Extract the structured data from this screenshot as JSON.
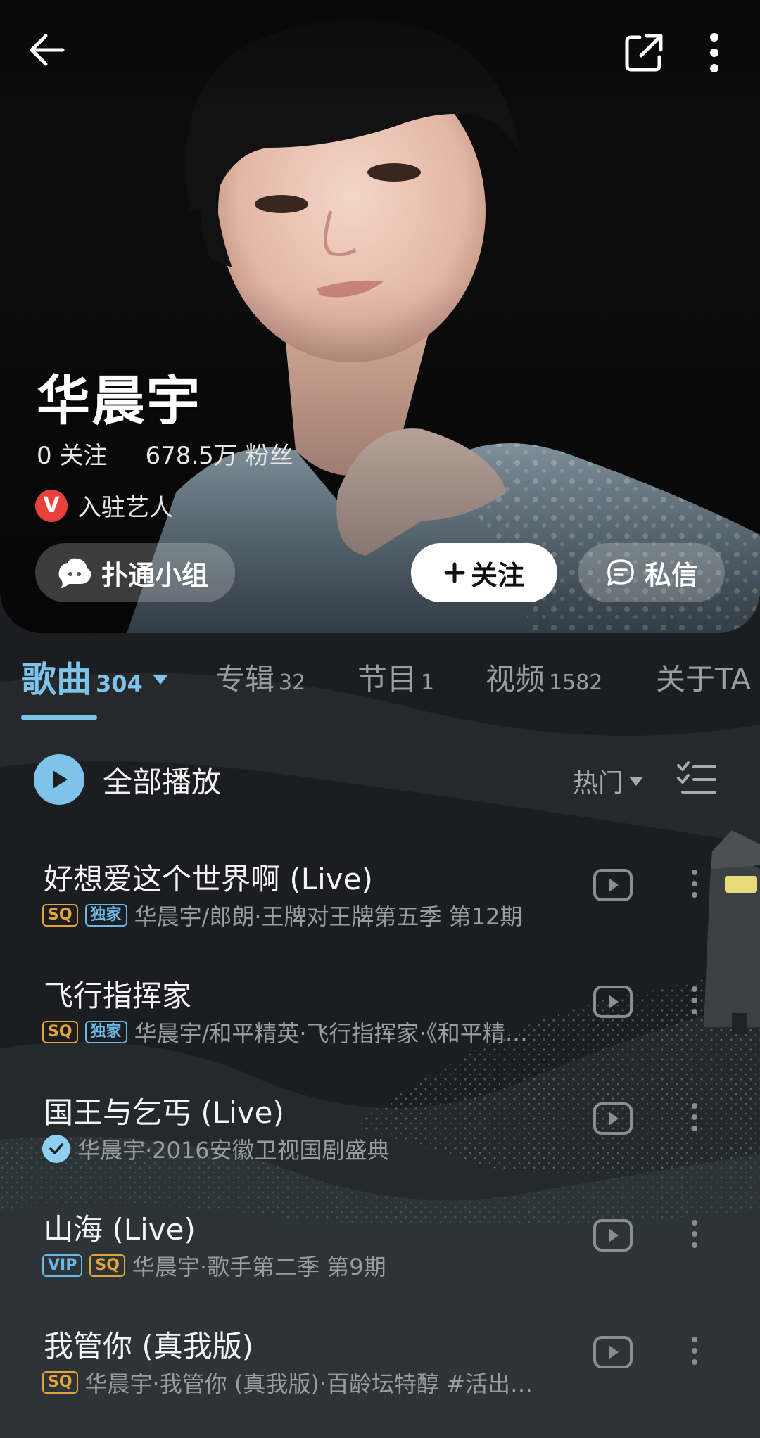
{
  "artist": {
    "name": "华晨宇",
    "following": "0 关注",
    "fans": "678.5万 粉丝",
    "verified_badge": "V",
    "verified_label": "入驻艺人"
  },
  "actions": {
    "group_label": "扑通小组",
    "follow_label": "关注",
    "message_label": "私信"
  },
  "tabs": [
    {
      "label": "歌曲",
      "count": "304",
      "active": true
    },
    {
      "label": "专辑",
      "count": "32"
    },
    {
      "label": "节目",
      "count": "1"
    },
    {
      "label": "视频",
      "count": "1582"
    },
    {
      "label": "关于TA",
      "count": ""
    }
  ],
  "toolbar": {
    "play_all_label": "全部播放",
    "sort_label": "热门"
  },
  "songs": [
    {
      "title": "好想爱这个世界啊 (Live)",
      "tags": [
        "SQ",
        "独家"
      ],
      "meta": "华晨宇/郎朗·王牌对王牌第五季 第12期"
    },
    {
      "title": "飞行指挥家",
      "tags": [
        "SQ",
        "独家"
      ],
      "meta": "华晨宇/和平精英·飞行指挥家·《和平精…"
    },
    {
      "title": "国王与乞丐 (Live)",
      "tags": [],
      "meta": "华晨宇·2016安徽卫视国剧盛典"
    },
    {
      "title": "山海 (Live)",
      "tags": [
        "VIP",
        "SQ"
      ],
      "meta": "华晨宇·歌手第二季 第9期"
    },
    {
      "title": "我管你 (真我版)",
      "tags": [
        "SQ"
      ],
      "meta": "华晨宇·我管你 (真我版)·百龄坛特醇 #活出…"
    }
  ],
  "icons": [
    "back-arrow-icon",
    "share-icon",
    "more-vertical-icon",
    "group-chat-icon",
    "plus-icon",
    "message-icon",
    "play-icon",
    "multi-select-icon",
    "mv-play-icon",
    "row-more-icon",
    "verified-check-icon"
  ],
  "colors": {
    "accent": "#7dc3ea",
    "background": "#1c1d20",
    "tag_sq": "#e5a43a",
    "tag_blue": "#6cb8e4",
    "verified_red": "#e8413c"
  }
}
